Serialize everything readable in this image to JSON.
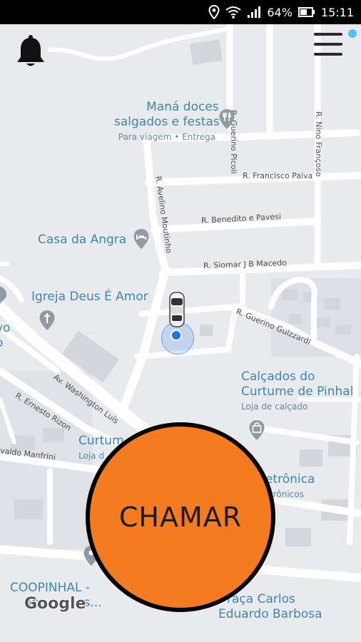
{
  "status_bar": {
    "battery": "64%",
    "time": "15:11"
  },
  "map": {
    "pois": [
      {
        "name": "Maná doces",
        "name2": "salgados e festas",
        "sub": "Para viagem • Entrega",
        "icon": "restaurant-icon"
      },
      {
        "name": "Casa da Angra",
        "icon": "hotel-icon"
      },
      {
        "name": "Igreja Deus É Amor",
        "icon": "church-icon"
      },
      {
        "name": "Calçados do",
        "name2": "Curtume de Pinhal",
        "sub": "Loja de calçado",
        "icon": "shopping-bag-icon"
      },
      {
        "name": "Curtum",
        "sub": "Loja d"
      },
      {
        "name": "etrônica",
        "sub": "trônicos"
      },
      {
        "name": "COOPINHAL -",
        "name2": "ope",
        "name3": "s...",
        "icon": "map-pin-icon"
      },
      {
        "name": "raça Carlos",
        "name2": "Eduardo Barbosa"
      },
      {
        "name": "vo",
        "name2": "o"
      }
    ],
    "streets": [
      "R. Guerino Picoli",
      "R. Nino Françoso",
      "R. Francisco Paiva",
      "R. Benedito e Pavesi",
      "R. Avelino Moutinho",
      "R. Siomar J B Macedo",
      "R. Guerino Gulzzardi",
      "Av. Washington Luís",
      "R. Ernesto Rizon",
      "valdo Manfrini"
    ],
    "attribution": "Google"
  },
  "call_button": {
    "label": "CHAMAR"
  },
  "colors": {
    "accent": "#f47b20",
    "map_bg": "#e8eaed",
    "road": "#ffffff",
    "poi_text": "#3f87a6",
    "user_dot": "#1a73e8",
    "notification": "#4fc3f7"
  }
}
